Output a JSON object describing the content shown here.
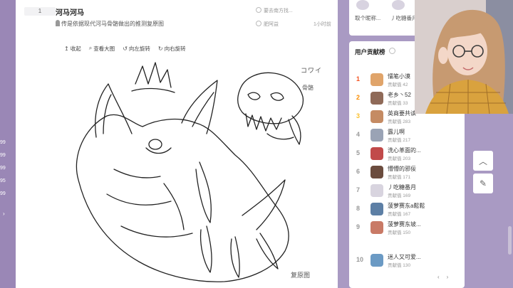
{
  "left": {
    "nums": [
      "99",
      "99",
      "99",
      "95",
      "99"
    ],
    "chevron": "›"
  },
  "post": {
    "floor": "1",
    "title": "河马河马",
    "desc": "传是依据现代河马骨骼做出的推测复原图",
    "source": "要去南方找...",
    "user": "肥阿益",
    "time": "1小时前",
    "toolbar": [
      {
        "icon": "↥",
        "label": "收起"
      },
      {
        "icon": "⌕",
        "label": "查看大图"
      },
      {
        "icon": "↺",
        "label": "向左旋转"
      },
      {
        "icon": "↻",
        "label": "向右旋转"
      }
    ],
    "image_caption": "复原图",
    "side_label": "骨骼",
    "kawaii": "コワイ"
  },
  "top_card": {
    "users": [
      "取个昵称...",
      "丿吃糖番月"
    ]
  },
  "ranking": {
    "title": "用户贡献榜",
    "rows": [
      {
        "rank": "1",
        "name": "懦笔小漠",
        "score": "贡献值 42",
        "color": "#e0a46a"
      },
      {
        "rank": "2",
        "name": "老乡丶52",
        "score": "贡献值 33",
        "color": "#8f6a58"
      },
      {
        "rank": "3",
        "name": "英商要共读",
        "score": "贡献值 283",
        "color": "#c58b63"
      },
      {
        "rank": "4",
        "name": "露儿啊",
        "score": "贡献值 217",
        "color": "#9aa3b5"
      },
      {
        "rank": "5",
        "name": "洗心革面的...",
        "score": "贡献值 203",
        "color": "#c14a4a"
      },
      {
        "rank": "6",
        "name": "懵懵的邪佞",
        "score": "贡献值 171",
        "color": "#6b4c3e"
      },
      {
        "rank": "7",
        "name": "丿吃糖番月",
        "score": "贡献值 169",
        "color": "#d8d4df"
      },
      {
        "rank": "8",
        "name": "菠萝赛东a鬆鬆",
        "score": "贡献值 167",
        "color": "#5d7fa5"
      },
      {
        "rank": "9",
        "name": "菠萝赛东坡...",
        "score": "贡献值 150",
        "color": "#c97a66"
      },
      {
        "rank": "10",
        "name": "迷人又可爱...",
        "score": "贡献值 130",
        "color": "#6b9ac4"
      }
    ],
    "pager_prev": "‹",
    "pager_next": "›"
  },
  "float_buttons": {
    "up": "︿",
    "edit": "✎"
  }
}
